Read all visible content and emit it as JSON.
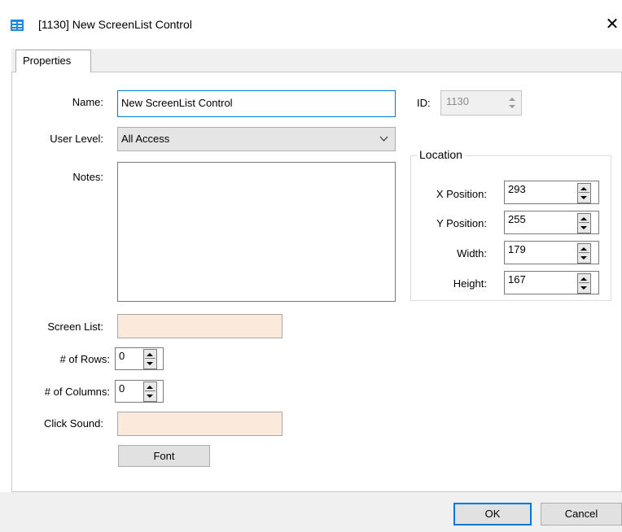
{
  "window": {
    "title": "[1130] New ScreenList Control",
    "close_glyph": "✕",
    "icon": "screenlist-app-icon"
  },
  "tabs": [
    {
      "label": "Properties",
      "active": true
    }
  ],
  "form": {
    "name_label": "Name:",
    "name_value": "New ScreenList Control",
    "id_label": "ID:",
    "id_value": "1130",
    "user_level_label": "User Level:",
    "user_level_value": "All Access",
    "notes_label": "Notes:",
    "notes_value": "",
    "screen_list_label": "Screen List:",
    "screen_list_value": "",
    "rows_label": "# of Rows:",
    "rows_value": "0",
    "columns_label": "# of Columns:",
    "columns_value": "0",
    "click_sound_label": "Click Sound:",
    "click_sound_value": "",
    "font_button": "Font"
  },
  "location": {
    "title": "Location",
    "x_label": "X Position:",
    "x_value": "293",
    "y_label": "Y Position:",
    "y_value": "255",
    "width_label": "Width:",
    "width_value": "179",
    "height_label": "Height:",
    "height_value": "167"
  },
  "footer": {
    "ok": "OK",
    "cancel": "Cancel"
  },
  "colors": {
    "accent": "#0078d7",
    "peach_field": "#fbeadb",
    "dialog_bg": "#f0f0f0"
  }
}
